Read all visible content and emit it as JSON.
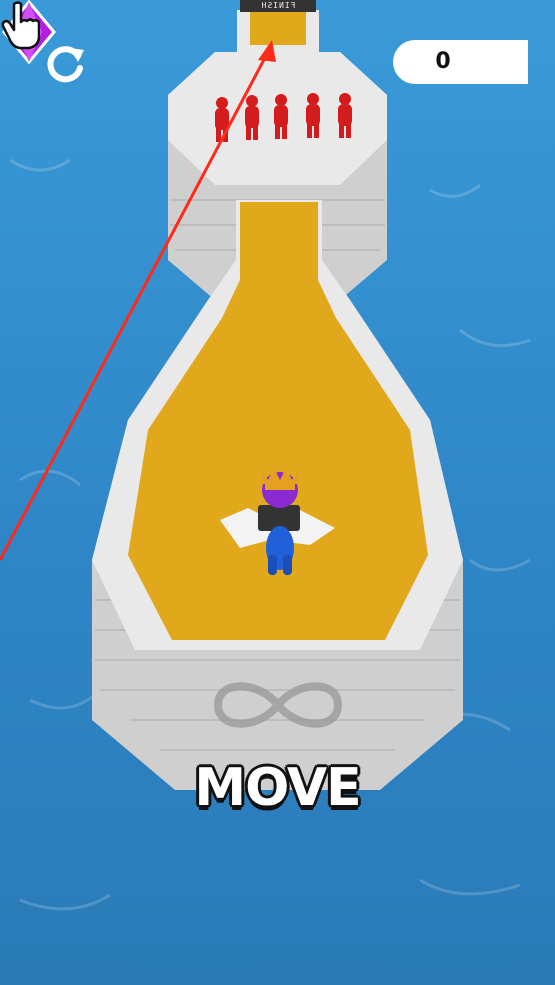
{
  "hud": {
    "restart_icon": "restart-icon",
    "gem_count": "0",
    "gem_icon": "purple-diamond-icon",
    "gem_color": "#b020e0"
  },
  "track": {
    "finish_label": "FINISH",
    "path_color": "#e2a81c",
    "wall_color": "#e8e8e8"
  },
  "tutorial": {
    "instruction": "MOVE",
    "gesture_icon": "pointer-hand-icon",
    "gesture_path_icon": "infinity-icon"
  },
  "colors": {
    "water": "#2f8fd0",
    "player": "#2060d8",
    "enemies": "#d41c1c",
    "aim_line": "#ff2a1a"
  }
}
